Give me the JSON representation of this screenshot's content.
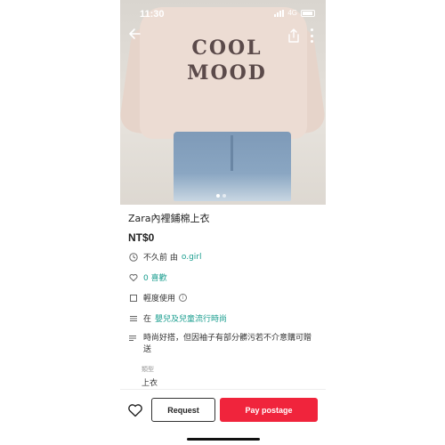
{
  "status_bar": {
    "time": "11:30",
    "network": "4G"
  },
  "photo": {
    "print_text_line1": "COOL",
    "print_text_line2": "MOOD",
    "page_count": 2,
    "current_page": 1
  },
  "item": {
    "title": "Zara內裡鋪棉上衣",
    "price": "NT$0",
    "posted_prefix": "不久前 由",
    "seller": "o.girl",
    "likes": "0 喜歡",
    "condition": "輕度使用",
    "category_prefix": "在",
    "category": "嬰兒及兒童流行時尚",
    "description": "時尚好搭，但因袖子有部分髒污若不介意購可贈送",
    "attribute_label": "類型",
    "attribute_value": "上衣"
  },
  "actions": {
    "request_label": "Request",
    "pay_label": "Pay postage"
  },
  "colors": {
    "accent_teal": "#1a9e8f",
    "pay_red": "#f0243c"
  },
  "icons": {
    "back": "arrow-left-icon",
    "share": "share-icon",
    "more": "more-vertical-icon",
    "time": "clock-icon",
    "like": "heart-icon",
    "condition": "tag-icon",
    "info": "info-icon",
    "category": "menu-lines-icon",
    "description": "text-lines-icon"
  }
}
